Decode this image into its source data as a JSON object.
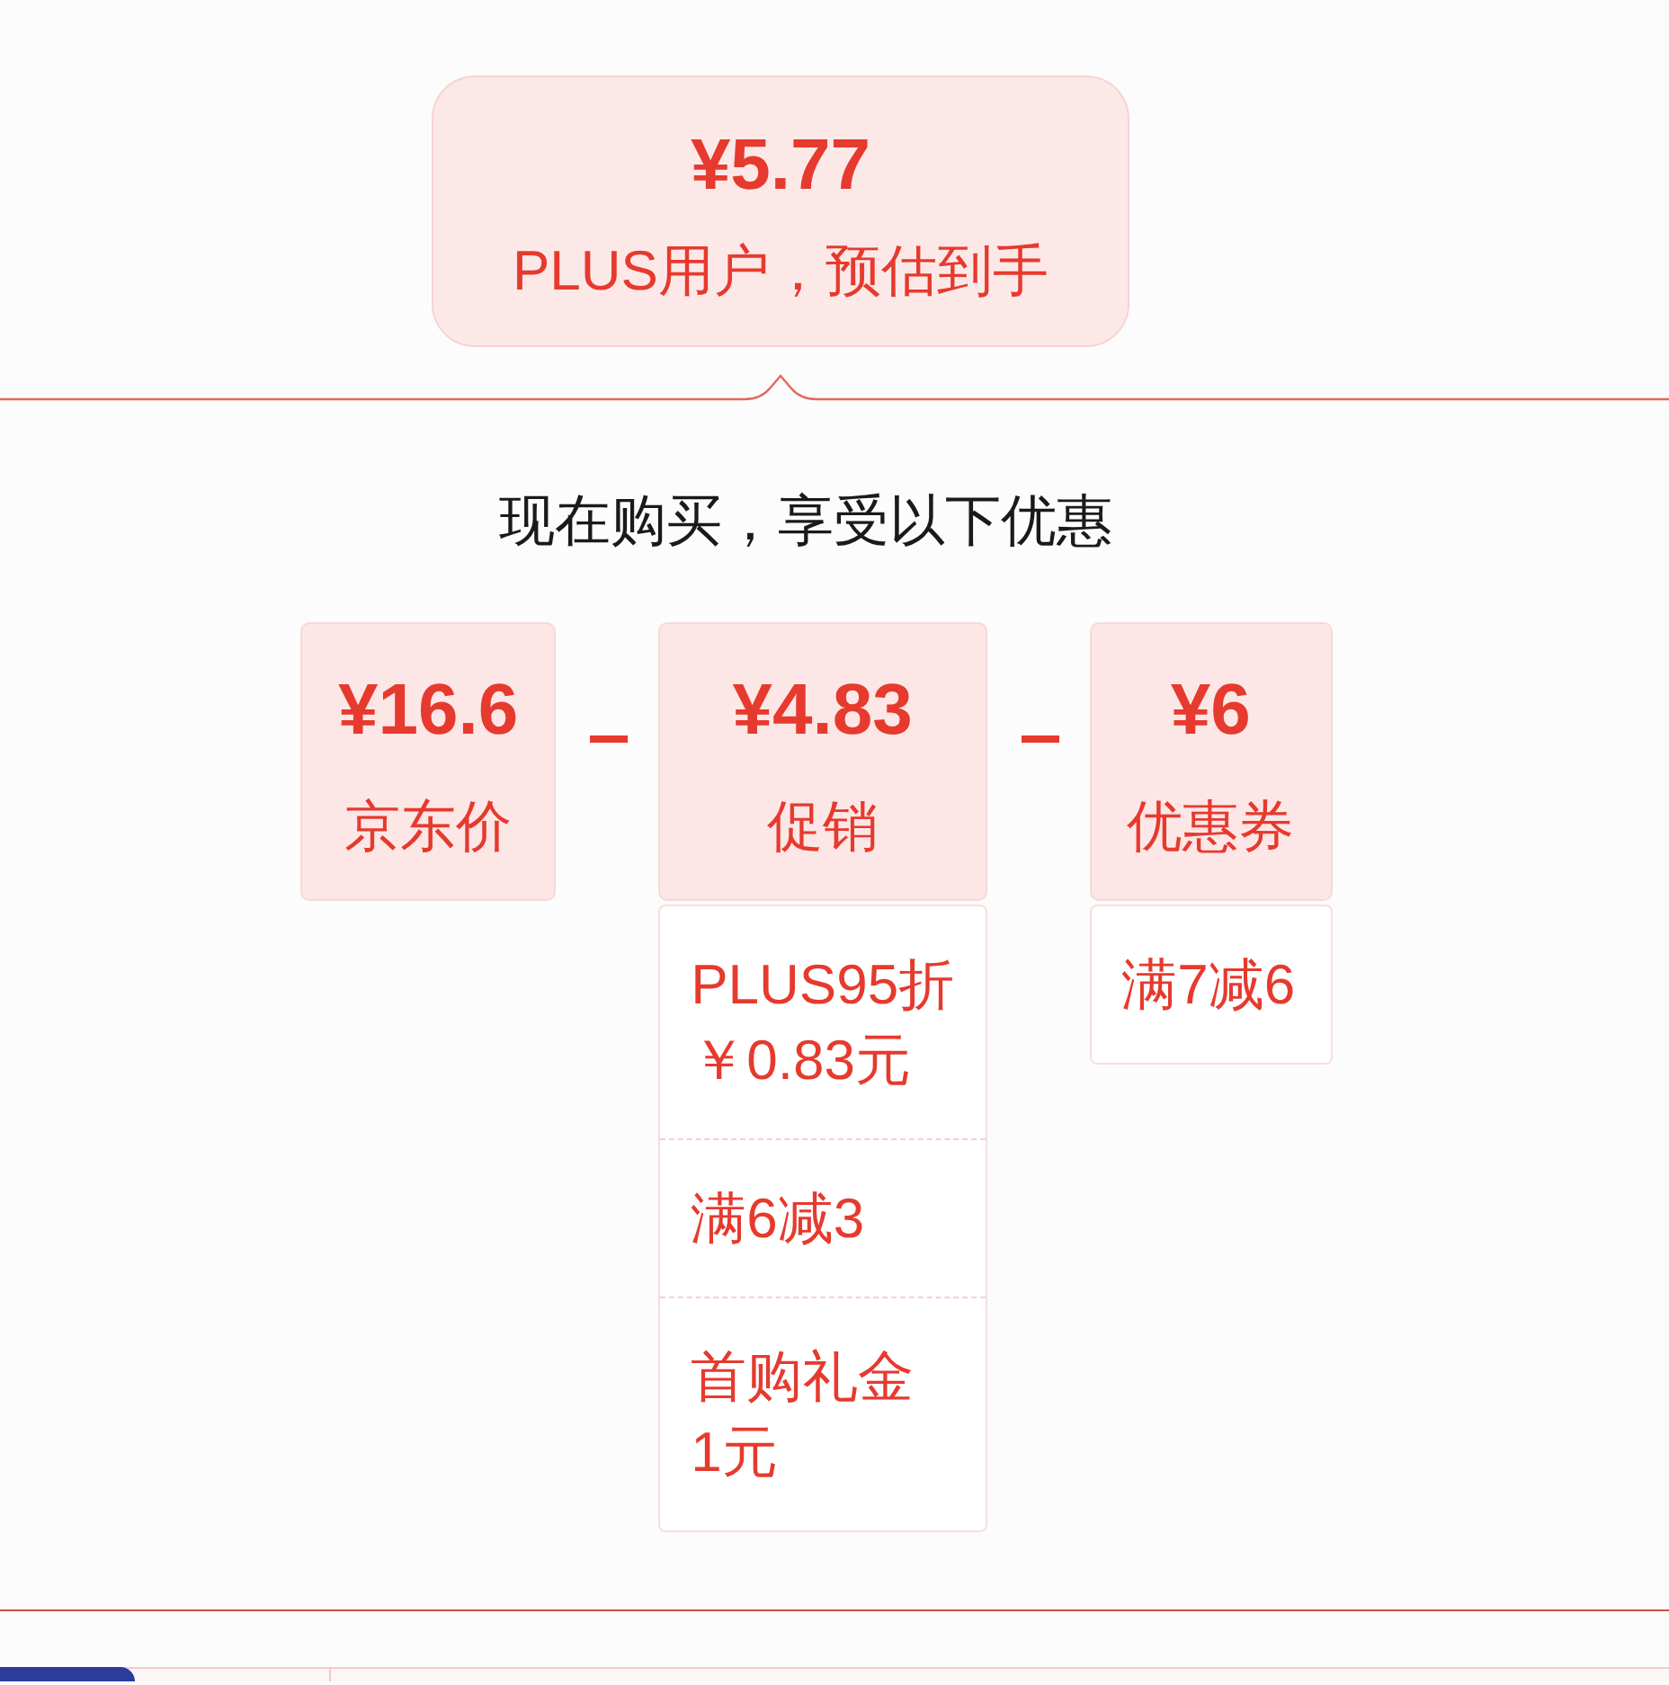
{
  "estimate": {
    "price": "¥5.77",
    "caption": "PLUS用户，预估到手"
  },
  "heading": "现在购买，享受以下优惠",
  "breakdown": [
    {
      "amount": "¥16.6",
      "label": "京东价"
    },
    {
      "amount": "¥4.83",
      "label": "促销",
      "details": [
        {
          "name": "PLUS95折",
          "value": "￥0.83元"
        },
        {
          "name": "满6减3"
        },
        {
          "name": "首购礼金",
          "value": "1元"
        }
      ]
    },
    {
      "amount": "¥6",
      "label": "优惠券",
      "details": [
        {
          "name": "满7减6"
        }
      ]
    }
  ]
}
